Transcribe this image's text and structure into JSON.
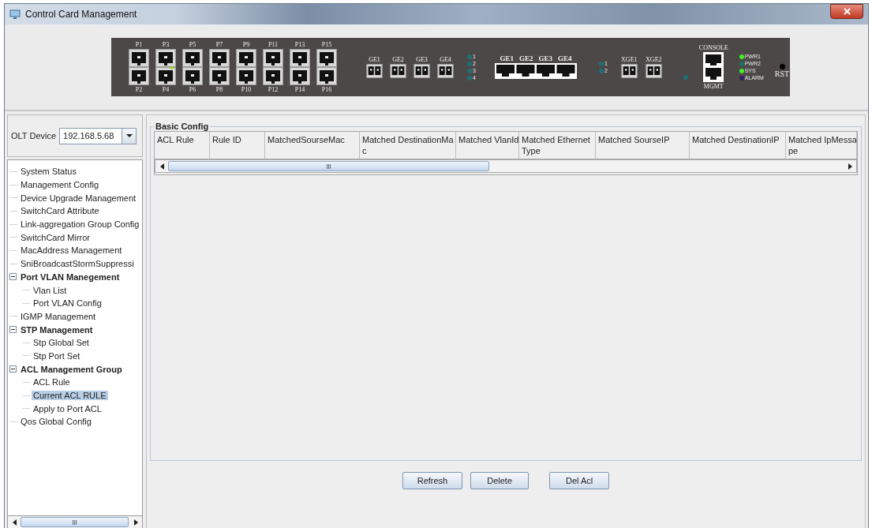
{
  "window": {
    "title": "Control Card Management"
  },
  "device": {
    "sfp_ports": [
      {
        "top": "P1",
        "bottom": "P2",
        "link": false
      },
      {
        "top": "P3",
        "bottom": "P4",
        "link": true
      },
      {
        "top": "P5",
        "bottom": "P6",
        "link": false
      },
      {
        "top": "P7",
        "bottom": "P8",
        "link": false
      },
      {
        "top": "P9",
        "bottom": "P10",
        "link": false
      },
      {
        "top": "P11",
        "bottom": "P12",
        "link": false
      },
      {
        "top": "P13",
        "bottom": "P14",
        "link": false
      },
      {
        "top": "P15",
        "bottom": "P16",
        "link": false
      }
    ],
    "ge_sfp": [
      "GE1",
      "GE2",
      "GE3",
      "GE4"
    ],
    "ge_leds": [
      "1",
      "2",
      "3",
      "4"
    ],
    "ge_rj45": [
      "GE1",
      "GE2",
      "GE3",
      "GE4"
    ],
    "xge_leds": [
      "1",
      "2"
    ],
    "xge_ports": [
      "XGE1",
      "XGE2"
    ],
    "console": "CONSOLE",
    "mgmt": "MGMT",
    "status_leds": [
      {
        "label": "PWR1",
        "color": "#44ee22"
      },
      {
        "label": "PWR2",
        "color": "#1e6e6a"
      },
      {
        "label": "SYS",
        "color": "#44ee22"
      },
      {
        "label": "ALARM",
        "color": "#3a1a5a"
      }
    ],
    "reset": "RST"
  },
  "sidebar": {
    "device_label": "OLT Device",
    "device_value": "192.168.5.68",
    "tree": [
      {
        "label": "System Status",
        "selected": false
      },
      {
        "label": "Management Config",
        "selected": false
      },
      {
        "label": "Device Upgrade Management",
        "selected": false
      },
      {
        "label": "SwitchCard Attribute",
        "selected": false
      },
      {
        "label": "Link-aggregation Group Config",
        "selected": false
      },
      {
        "label": "SwitchCard Mirror",
        "selected": false
      },
      {
        "label": "MacAddress Management",
        "selected": false
      },
      {
        "label": "SniBroadcastStormSuppressi",
        "selected": false
      },
      {
        "label": "Port VLAN Manegement",
        "selected": false,
        "expanded": true,
        "children": [
          {
            "label": "Vlan List",
            "selected": false
          },
          {
            "label": "Port VLAN Config",
            "selected": false
          }
        ]
      },
      {
        "label": "IGMP Management",
        "selected": false
      },
      {
        "label": "STP Management",
        "selected": false,
        "expanded": true,
        "children": [
          {
            "label": "Stp Global Set",
            "selected": false
          },
          {
            "label": "Stp Port Set",
            "selected": false
          }
        ]
      },
      {
        "label": "ACL Management Group",
        "selected": false,
        "expanded": true,
        "children": [
          {
            "label": "ACL Rule",
            "selected": false
          },
          {
            "label": "Current ACL RULE",
            "selected": true
          },
          {
            "label": "Apply to Port ACL",
            "selected": false
          }
        ]
      },
      {
        "label": "Qos Global Config",
        "selected": false
      }
    ]
  },
  "panel": {
    "title": "Basic Config",
    "columns": [
      {
        "lines": [
          "ACL Rule"
        ]
      },
      {
        "lines": [
          "Rule ID"
        ]
      },
      {
        "lines": [
          "MatchedSourseMac"
        ]
      },
      {
        "lines": [
          "Matched DestinationMa",
          "c"
        ]
      },
      {
        "lines": [
          "Matched VlanId"
        ]
      },
      {
        "lines": [
          "Matched Ethernet",
          "Type"
        ]
      },
      {
        "lines": [
          "Matched SourseIP"
        ]
      },
      {
        "lines": [
          "Matched DestinationIP"
        ]
      },
      {
        "lines": [
          "Matched IpMessa",
          "pe"
        ]
      }
    ],
    "buttons": [
      "Refresh",
      "Delete",
      "Del Acl"
    ]
  }
}
